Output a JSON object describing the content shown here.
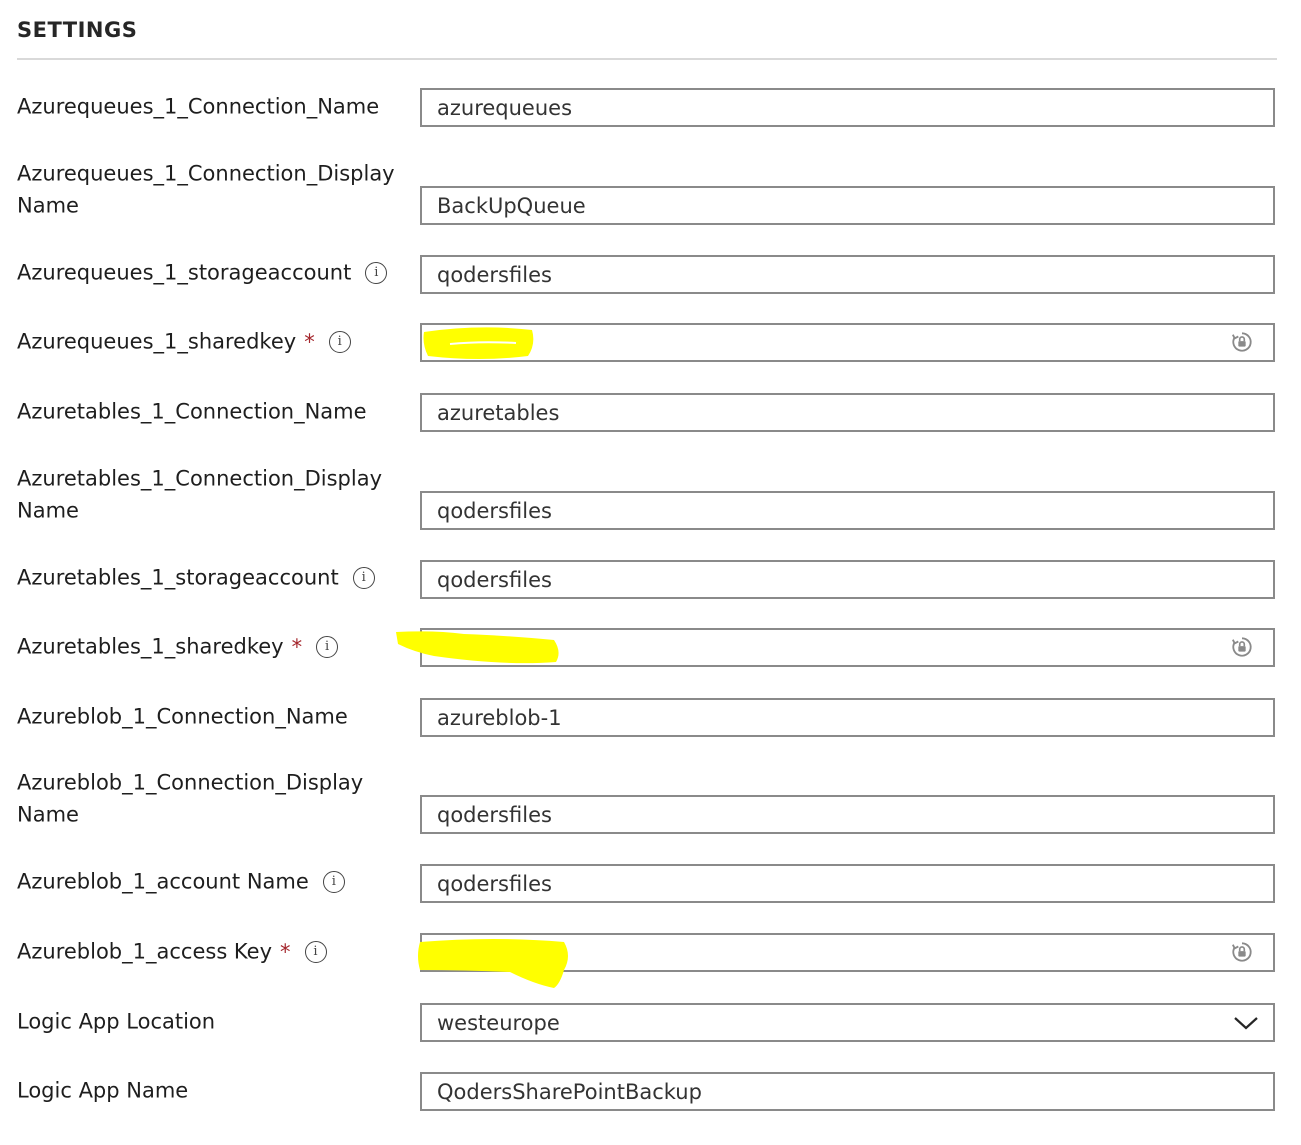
{
  "section": {
    "title": "SETTINGS"
  },
  "fields": [
    {
      "label": "Azurequeues_1_Connection_Name",
      "value": "azurequeues"
    },
    {
      "label": "Azurequeues_1_Connection_Display Name",
      "value": "BackUpQueue"
    },
    {
      "label": "Azurequeues_1_storageaccount",
      "value": "qodersfiles",
      "info_icon": "info-icon"
    },
    {
      "label": "Azurequeues_1_sharedkey",
      "required_mark": "*",
      "info_icon": "info-icon",
      "value": "",
      "secure_icon": "lock-refresh-icon"
    },
    {
      "label": "Azuretables_1_Connection_Name",
      "value": "azuretables"
    },
    {
      "label": "Azuretables_1_Connection_Display Name",
      "value": "qodersfiles"
    },
    {
      "label": "Azuretables_1_storageaccount",
      "value": "qodersfiles",
      "info_icon": "info-icon"
    },
    {
      "label": "Azuretables_1_sharedkey",
      "required_mark": "*",
      "info_icon": "info-icon",
      "value": "",
      "secure_icon": "lock-refresh-icon"
    },
    {
      "label": "Azureblob_1_Connection_Name",
      "value": "azureblob-1"
    },
    {
      "label": "Azureblob_1_Connection_Display Name",
      "value": "qodersfiles"
    },
    {
      "label": "Azureblob_1_account Name",
      "value": "qodersfiles",
      "info_icon": "info-icon"
    },
    {
      "label": "Azureblob_1_access Key",
      "required_mark": "*",
      "info_icon": "info-icon",
      "value": "",
      "secure_icon": "lock-refresh-icon"
    },
    {
      "label": "Logic App Location",
      "value": "westeurope",
      "dropdown_icon": "chevron-down-icon"
    },
    {
      "label": "Logic App Name",
      "value": "QodersSharePointBackup"
    }
  ],
  "colors": {
    "field_border": "#8a8a8a",
    "required": "#a4262c",
    "highlight": "#ffff00",
    "divider": "#d9d9d9"
  }
}
